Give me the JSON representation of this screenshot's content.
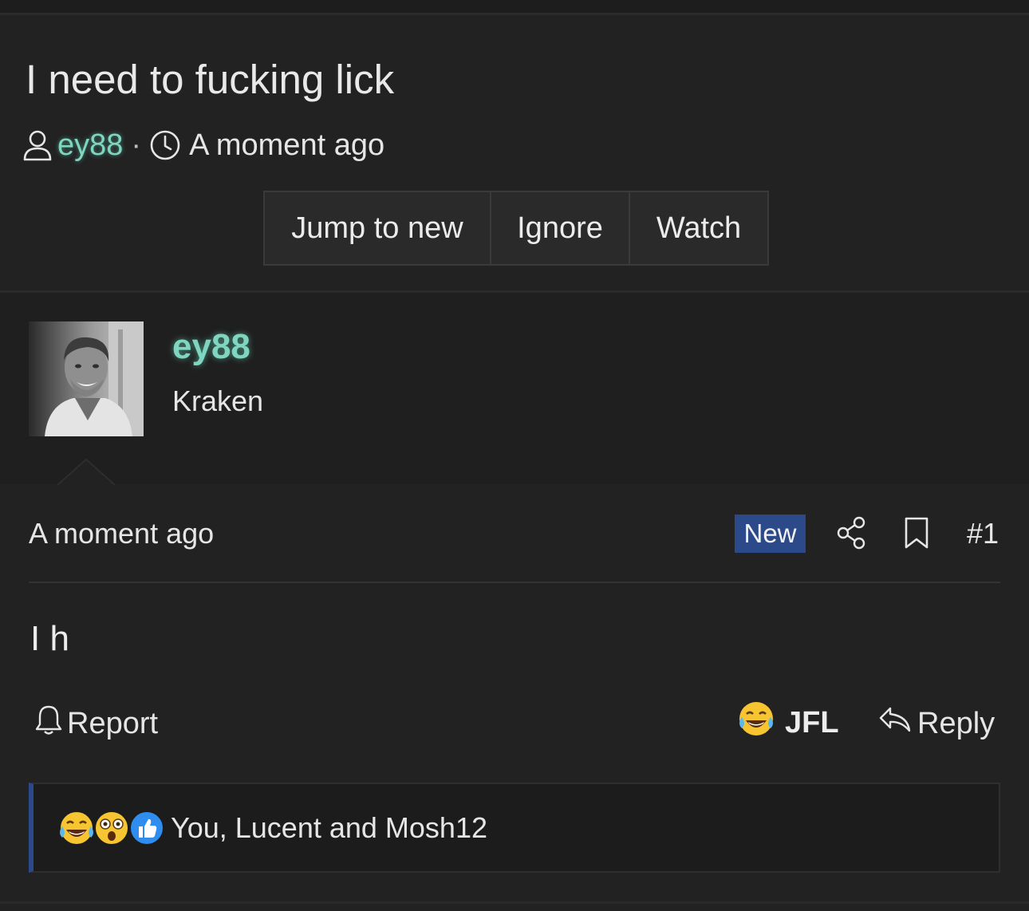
{
  "thread": {
    "title": "I need to fucking lick",
    "author": "ey88",
    "separator": "·",
    "time": "A moment ago",
    "buttons": {
      "jump_to_new": "Jump to new",
      "ignore": "Ignore",
      "watch": "Watch"
    }
  },
  "post": {
    "poster_name": "ey88",
    "poster_title": "Kraken",
    "date": "A moment ago",
    "badge": "New",
    "number": "#1",
    "message": "I h",
    "actions": {
      "report": "Report",
      "react": "JFL",
      "reply": "Reply"
    },
    "reactions": {
      "icons": [
        "crying-laughing-emoji",
        "shocked-emoji",
        "thumbs-up-emoji"
      ],
      "names": "You, Lucent and Mosh12"
    }
  },
  "colors": {
    "background": "#1d1d1d",
    "username": "#7fd6c0",
    "badge": "#2c4a8a",
    "reaction_bar_accent": "#2c4a8a"
  }
}
